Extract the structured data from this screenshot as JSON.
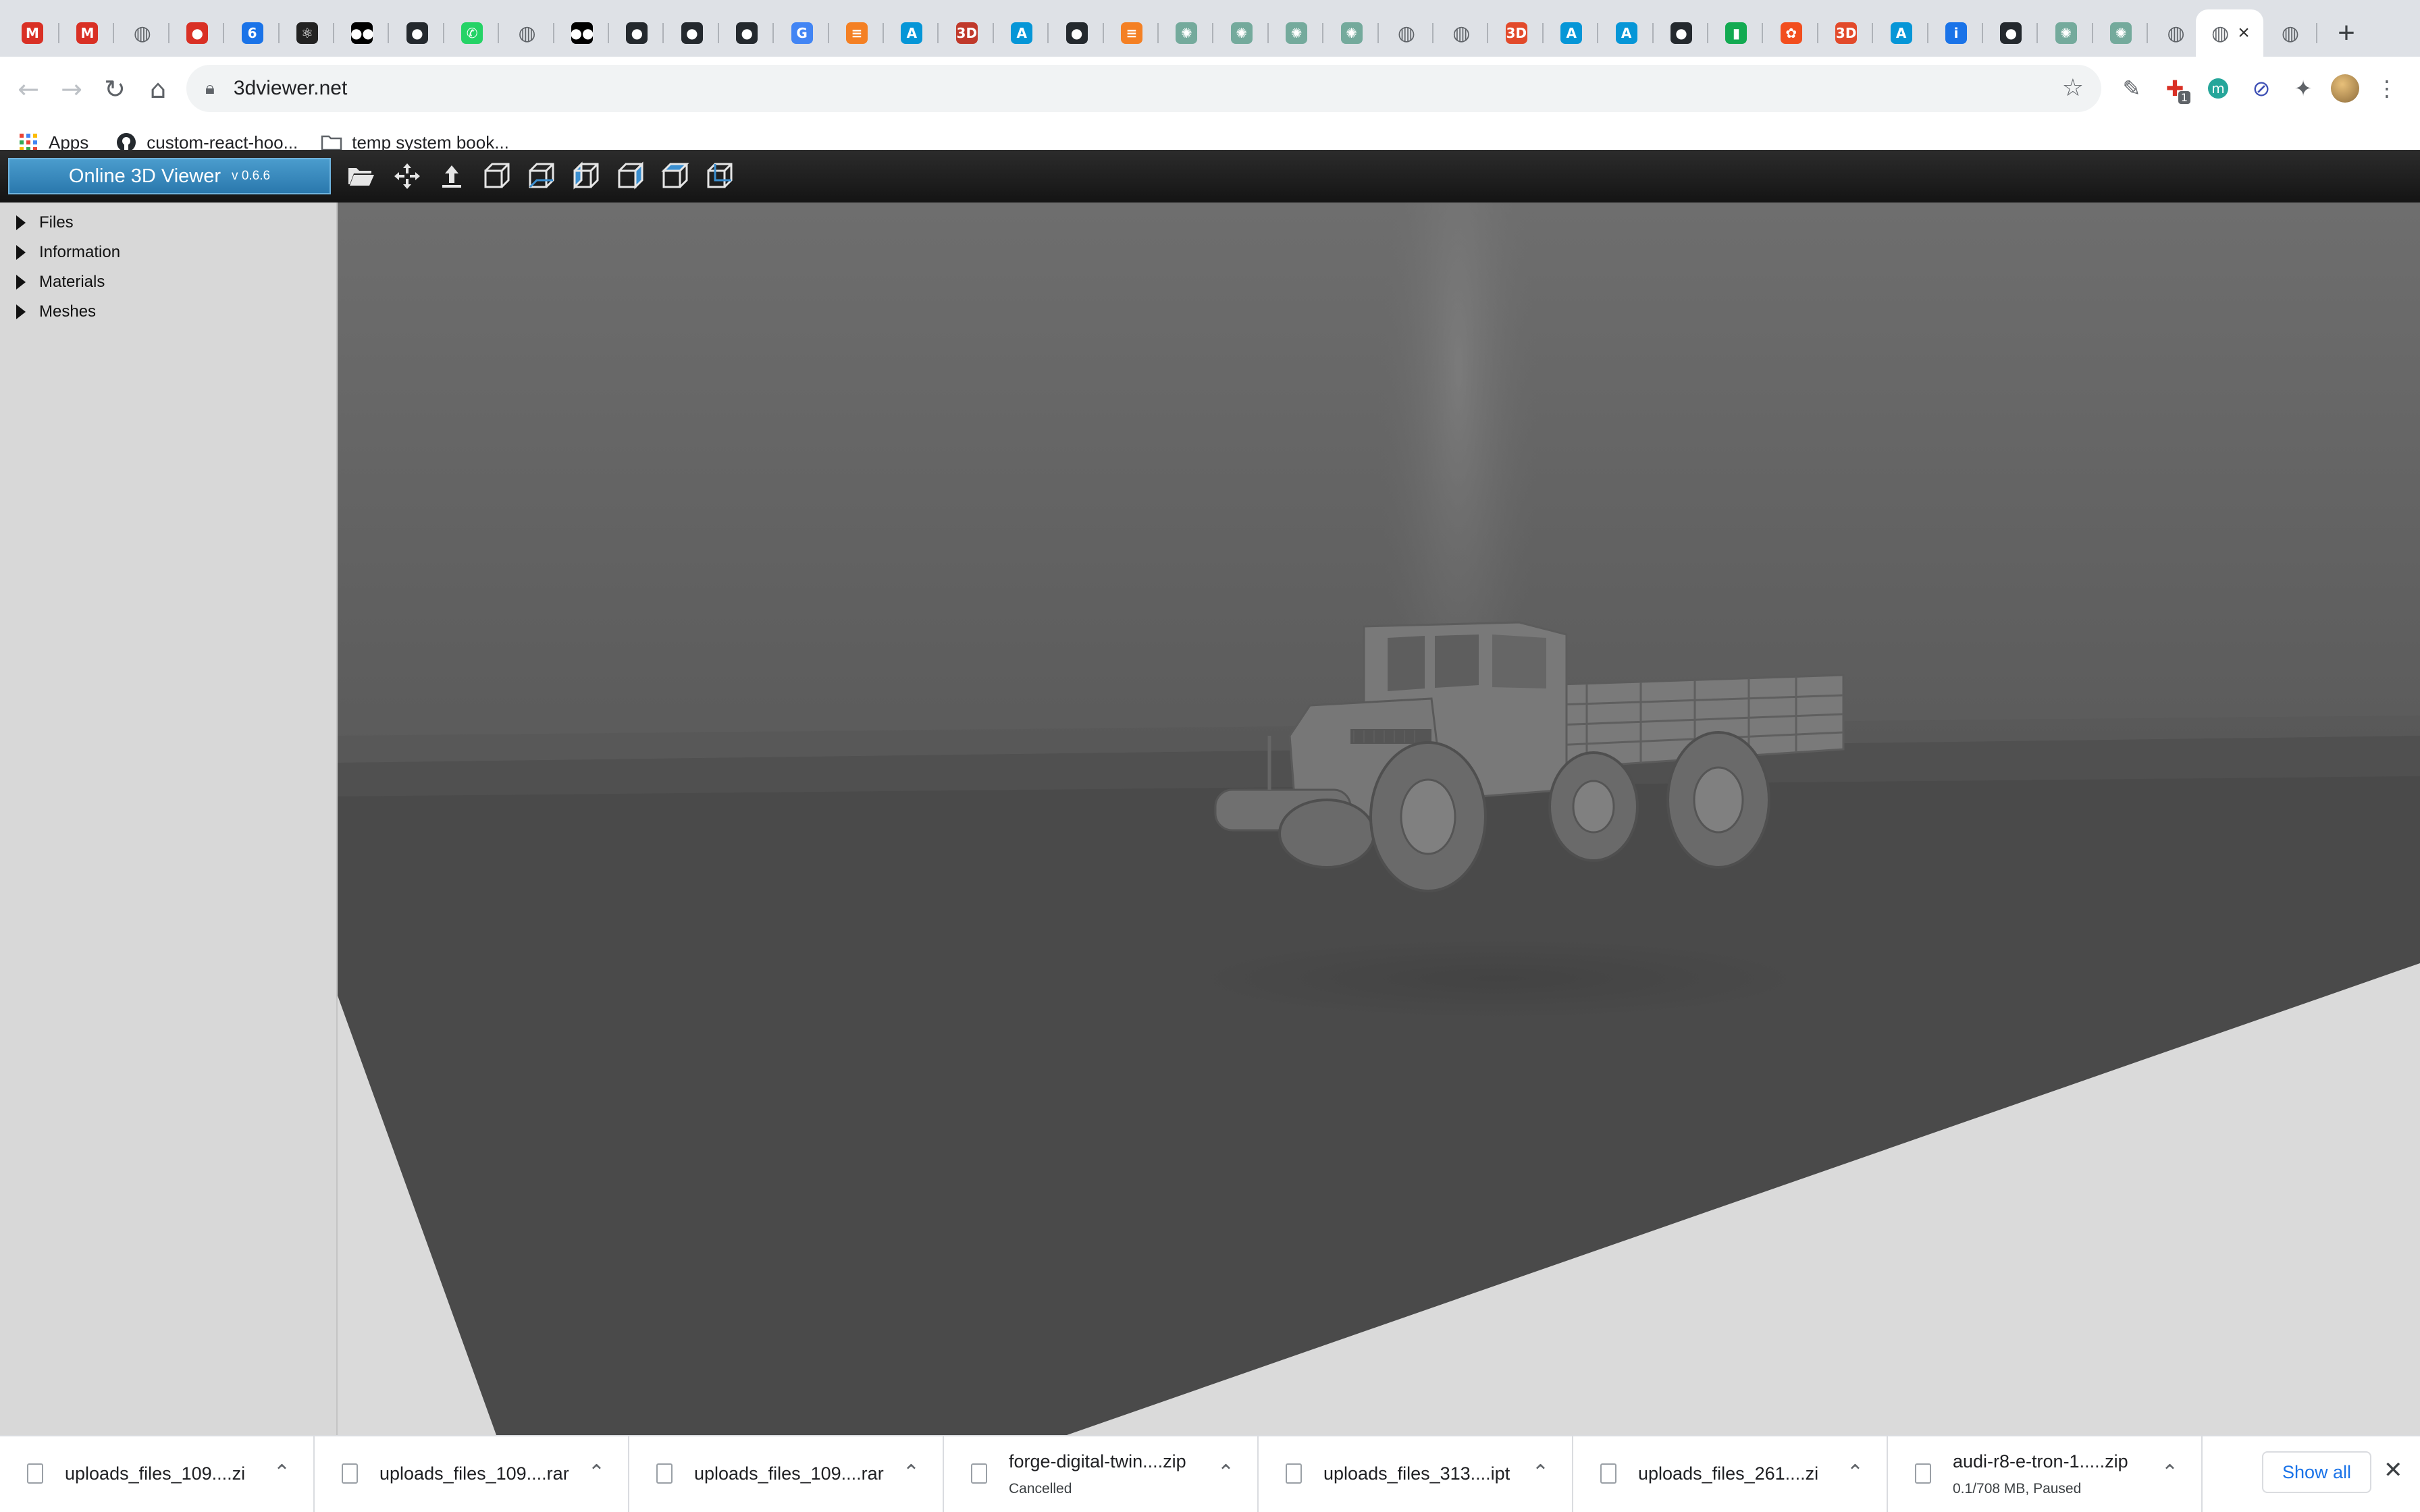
{
  "browser": {
    "tabs": [
      {
        "icon": "gmail-icon",
        "letter": "M",
        "color": "#d93025"
      },
      {
        "icon": "gmail-icon",
        "letter": "M",
        "color": "#d93025"
      },
      {
        "icon": "globe-icon",
        "letter": "◍",
        "color": "#5f6368"
      },
      {
        "icon": "record-icon",
        "letter": "●",
        "color": "#d93025"
      },
      {
        "icon": "calendar-icon",
        "letter": "6",
        "color": "#1a73e8"
      },
      {
        "icon": "react-icon",
        "letter": "⚛",
        "color": "#222222"
      },
      {
        "icon": "medium-icon",
        "letter": "●●",
        "color": "#000000"
      },
      {
        "icon": "github-icon",
        "letter": "●",
        "color": "#24292e"
      },
      {
        "icon": "whatsapp-icon",
        "letter": "✆",
        "color": "#25d366"
      },
      {
        "icon": "globe-icon",
        "letter": "◍",
        "color": "#5f6368"
      },
      {
        "icon": "medium-icon",
        "letter": "●●",
        "color": "#000000"
      },
      {
        "icon": "github-icon",
        "letter": "●",
        "color": "#24292e"
      },
      {
        "icon": "github-icon",
        "letter": "●",
        "color": "#24292e"
      },
      {
        "icon": "github-icon",
        "letter": "●",
        "color": "#24292e"
      },
      {
        "icon": "google-icon",
        "letter": "G",
        "color": "#4285f4"
      },
      {
        "icon": "stackoverflow-icon",
        "letter": "≡",
        "color": "#f48024"
      },
      {
        "icon": "autodesk-icon",
        "letter": "A",
        "color": "#0696d7"
      },
      {
        "icon": "3dviewer-icon",
        "letter": "3D",
        "color": "#c0392b"
      },
      {
        "icon": "autodesk-icon",
        "letter": "A",
        "color": "#0696d7"
      },
      {
        "icon": "github-icon",
        "letter": "●",
        "color": "#24292e"
      },
      {
        "icon": "stackoverflow-icon",
        "letter": "≡",
        "color": "#f48024"
      },
      {
        "icon": "chatgpt-icon",
        "letter": "✺",
        "color": "#74aa9c"
      },
      {
        "icon": "chatgpt-icon",
        "letter": "✺",
        "color": "#74aa9c"
      },
      {
        "icon": "chatgpt-icon",
        "letter": "✺",
        "color": "#74aa9c"
      },
      {
        "icon": "chatgpt-icon",
        "letter": "✺",
        "color": "#74aa9c"
      },
      {
        "icon": "globe-icon",
        "letter": "◍",
        "color": "#5f6368"
      },
      {
        "icon": "globe-icon",
        "letter": "◍",
        "color": "#5f6368"
      },
      {
        "icon": "3dviewer-icon",
        "letter": "3D",
        "color": "#e24a2b"
      },
      {
        "icon": "autodesk-icon",
        "letter": "A",
        "color": "#0696d7"
      },
      {
        "icon": "autodesk-icon",
        "letter": "A",
        "color": "#0696d7"
      },
      {
        "icon": "github-icon",
        "letter": "●",
        "color": "#24292e"
      },
      {
        "icon": "mongodb-icon",
        "letter": "▮",
        "color": "#13aa52"
      },
      {
        "icon": "figma-icon",
        "letter": "✿",
        "color": "#f24e1e"
      },
      {
        "icon": "3dviewer-icon",
        "letter": "3D",
        "color": "#e24a2b"
      },
      {
        "icon": "autodesk-icon",
        "letter": "A",
        "color": "#0696d7"
      },
      {
        "icon": "info-icon",
        "letter": "i",
        "color": "#1a73e8"
      },
      {
        "icon": "github-icon",
        "letter": "●",
        "color": "#24292e"
      },
      {
        "icon": "chatgpt-icon",
        "letter": "✺",
        "color": "#74aa9c"
      },
      {
        "icon": "chatgpt-icon",
        "letter": "✺",
        "color": "#74aa9c"
      },
      {
        "icon": "globe-icon",
        "letter": "◍",
        "color": "#5f6368"
      }
    ],
    "active_tab": {
      "icon": "globe-icon",
      "letter": "◍",
      "color": "#5f6368"
    },
    "trailing_tab": {
      "icon": "globe-icon",
      "letter": "◍",
      "color": "#5f6368"
    },
    "url": "3dviewer.net",
    "bookmarks": [
      {
        "label": "Apps",
        "icon": "apps-grid-icon"
      },
      {
        "label": "custom-react-hoo...",
        "icon": "github-icon"
      },
      {
        "label": "temp system book...",
        "icon": "folder-icon"
      }
    ],
    "extension_badge": "1"
  },
  "app": {
    "title": "Online 3D Viewer",
    "version": "v 0.6.6",
    "tree": [
      "Files",
      "Information",
      "Materials",
      "Meshes"
    ],
    "accent": "#2f80b7"
  },
  "downloads": [
    {
      "name": "uploads_files_109....zi",
      "status": ""
    },
    {
      "name": "uploads_files_109....rar",
      "status": ""
    },
    {
      "name": "uploads_files_109....rar",
      "status": ""
    },
    {
      "name": "forge-digital-twin....zip",
      "status": "Cancelled"
    },
    {
      "name": "uploads_files_313....ipt",
      "status": ""
    },
    {
      "name": "uploads_files_261....zi",
      "status": ""
    },
    {
      "name": "audi-r8-e-tron-1.....zip",
      "status": "0.1/708 MB, Paused"
    }
  ],
  "show_all_label": "Show all"
}
